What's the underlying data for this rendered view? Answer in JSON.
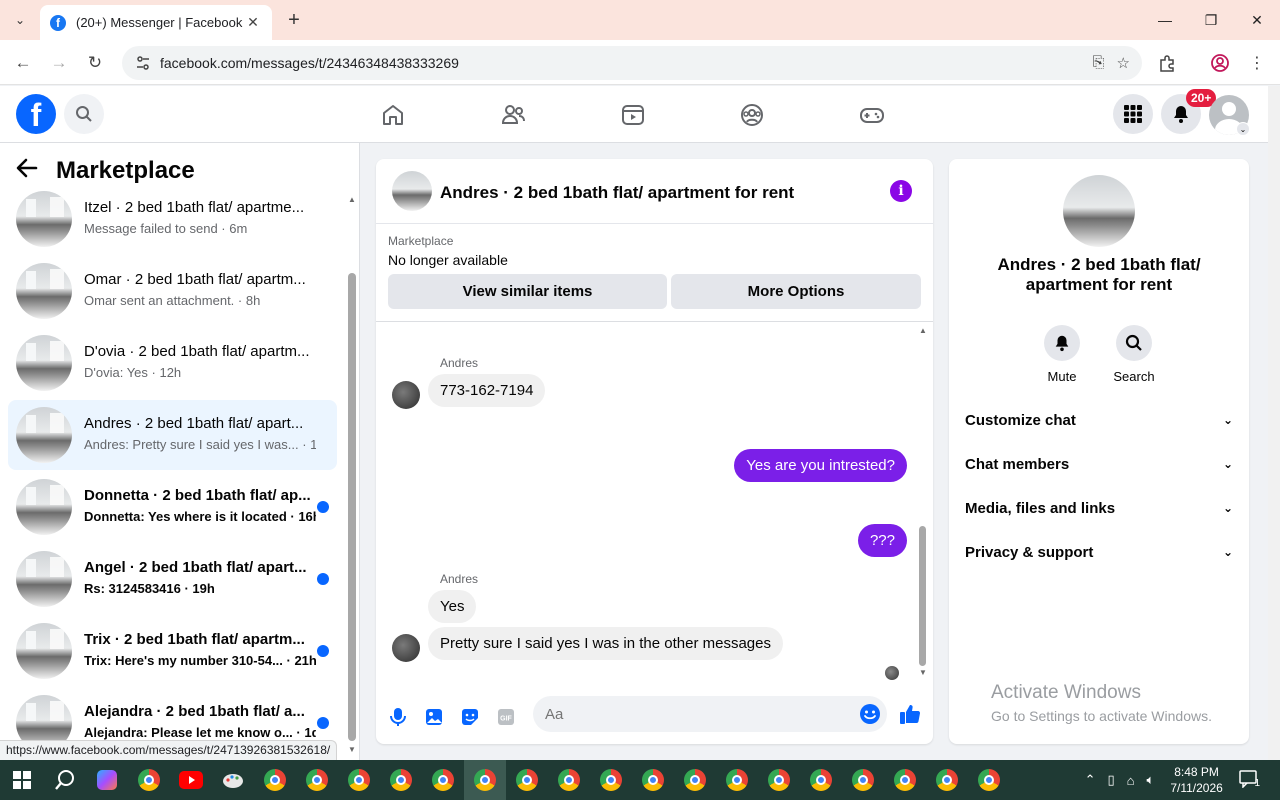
{
  "browser": {
    "tab_title": "(20+) Messenger | Facebook",
    "url": "facebook.com/messages/t/24346348438333269",
    "status_url": "https://www.facebook.com/messages/t/24713926381532618/"
  },
  "header": {
    "notification_badge": "20+"
  },
  "left": {
    "title": "Marketplace",
    "conversations": [
      {
        "name": "Itzel · 2 bed 1bath flat/ apartme...",
        "preview": "Message failed to send · 6m"
      },
      {
        "name": "Omar · 2 bed 1bath flat/ apartm...",
        "preview": "Omar sent an attachment. · 8h"
      },
      {
        "name": "D'ovia · 2 bed 1bath flat/ apartm...",
        "preview": "D'ovia: Yes · 12h"
      },
      {
        "name": "Andres · 2 bed 1bath flat/ apart...",
        "preview": "Andres: Pretty sure I said yes I was... · 13h"
      },
      {
        "name": "Donnetta · 2 bed 1bath flat/ ap...",
        "preview": "Donnetta: Yes where is it located · 16h"
      },
      {
        "name": "Angel · 2 bed 1bath flat/ apart...",
        "preview": "Rs: 3124583416 · 19h"
      },
      {
        "name": "Trix · 2 bed 1bath flat/ apartm...",
        "preview": "Trix: Here's my number 310-54... · 21h"
      },
      {
        "name": "Alejandra · 2 bed 1bath flat/ a...",
        "preview": "Alejandra: Please let me know o... · 1d"
      }
    ]
  },
  "chat": {
    "title": "Andres · 2 bed 1bath flat/ apartment for rent",
    "marketplace_label": "Marketplace",
    "listing_status": "No longer available",
    "view_similar": "View similar items",
    "more_options": "More Options",
    "messages": [
      {
        "sender": "Andres",
        "text": "773-162-7194"
      },
      {
        "sender": "",
        "text": "Yes are you intrested?"
      },
      {
        "sender": "",
        "text": "???"
      },
      {
        "sender": "Andres",
        "text": "Yes"
      },
      {
        "sender": "",
        "text": "Pretty sure I said yes I was in the other messages"
      }
    ],
    "composer_placeholder": "Aa"
  },
  "right": {
    "title": "Andres · 2 bed 1bath flat/ apartment for rent",
    "mute": "Mute",
    "search": "Search",
    "sections": [
      "Customize chat",
      "Chat members",
      "Media, files and links",
      "Privacy & support"
    ]
  },
  "watermark": {
    "line1": "Activate Windows",
    "line2": "Go to Settings to activate Windows."
  },
  "taskbar": {
    "time": "8:48 PM",
    "date": "7/11/2026",
    "notifications": "1"
  }
}
